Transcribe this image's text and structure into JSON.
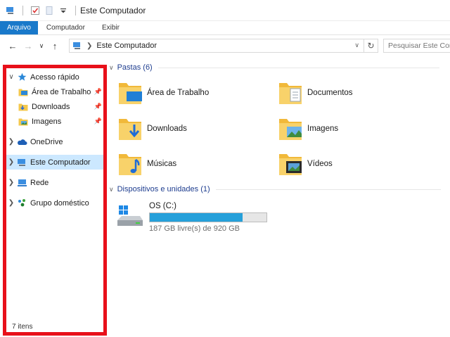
{
  "window": {
    "title": "Este Computador"
  },
  "ribbon": {
    "tabs": [
      "Arquivo",
      "Computador",
      "Exibir"
    ]
  },
  "address": {
    "path": "Este Computador",
    "search_placeholder": "Pesquisar Este Com"
  },
  "nav": {
    "items": [
      {
        "label": "Acesso rápido",
        "icon": "star-icon"
      },
      {
        "label": "Área de Trabalho",
        "icon": "desktop-folder-icon"
      },
      {
        "label": "Downloads",
        "icon": "downloads-folder-icon"
      },
      {
        "label": "Imagens",
        "icon": "pictures-folder-icon"
      },
      {
        "label": "OneDrive",
        "icon": "cloud-icon"
      },
      {
        "label": "Este Computador",
        "icon": "computer-icon"
      },
      {
        "label": "Rede",
        "icon": "network-icon"
      },
      {
        "label": "Grupo doméstico",
        "icon": "homegroup-icon"
      }
    ],
    "status": "7 itens",
    "highlight_color": "#e8101a",
    "selected_color": "#cce8ff"
  },
  "content": {
    "folders_header": "Pastas (6)",
    "folders": [
      {
        "label": "Área de Trabalho",
        "icon": "desktop-folder-icon"
      },
      {
        "label": "Documentos",
        "icon": "documents-folder-icon"
      },
      {
        "label": "Downloads",
        "icon": "downloads-folder-icon"
      },
      {
        "label": "Imagens",
        "icon": "pictures-folder-icon"
      },
      {
        "label": "Músicas",
        "icon": "music-folder-icon"
      },
      {
        "label": "Vídeos",
        "icon": "videos-folder-icon"
      }
    ],
    "devices_header": "Dispositivos e unidades (1)",
    "drive": {
      "name": "OS (C:)",
      "free_text": "187 GB livre(s) de 920 GB",
      "used_fraction": 0.797,
      "bar_color": "#26a0da"
    }
  },
  "colors": {
    "accent": "#1979ca",
    "header_text": "#1e3d8f"
  }
}
